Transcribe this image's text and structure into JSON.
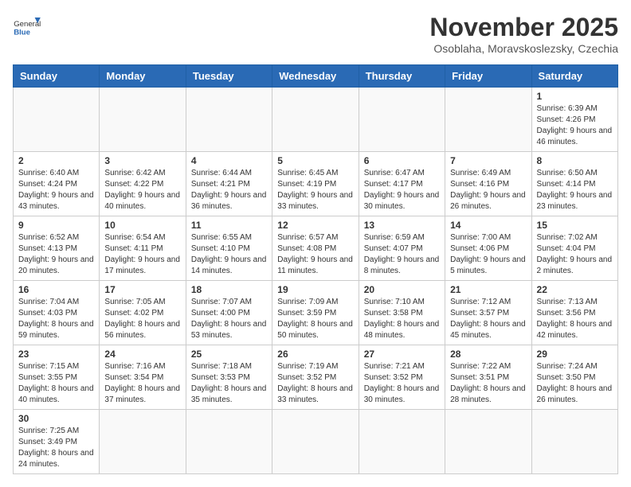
{
  "header": {
    "logo_text_normal": "General",
    "logo_text_bold": "Blue",
    "month_title": "November 2025",
    "location": "Osoblaha, Moravskoslezsky, Czechia"
  },
  "weekdays": [
    "Sunday",
    "Monday",
    "Tuesday",
    "Wednesday",
    "Thursday",
    "Friday",
    "Saturday"
  ],
  "weeks": [
    [
      {
        "day": "",
        "info": ""
      },
      {
        "day": "",
        "info": ""
      },
      {
        "day": "",
        "info": ""
      },
      {
        "day": "",
        "info": ""
      },
      {
        "day": "",
        "info": ""
      },
      {
        "day": "",
        "info": ""
      },
      {
        "day": "1",
        "info": "Sunrise: 6:39 AM\nSunset: 4:26 PM\nDaylight: 9 hours and 46 minutes."
      }
    ],
    [
      {
        "day": "2",
        "info": "Sunrise: 6:40 AM\nSunset: 4:24 PM\nDaylight: 9 hours and 43 minutes."
      },
      {
        "day": "3",
        "info": "Sunrise: 6:42 AM\nSunset: 4:22 PM\nDaylight: 9 hours and 40 minutes."
      },
      {
        "day": "4",
        "info": "Sunrise: 6:44 AM\nSunset: 4:21 PM\nDaylight: 9 hours and 36 minutes."
      },
      {
        "day": "5",
        "info": "Sunrise: 6:45 AM\nSunset: 4:19 PM\nDaylight: 9 hours and 33 minutes."
      },
      {
        "day": "6",
        "info": "Sunrise: 6:47 AM\nSunset: 4:17 PM\nDaylight: 9 hours and 30 minutes."
      },
      {
        "day": "7",
        "info": "Sunrise: 6:49 AM\nSunset: 4:16 PM\nDaylight: 9 hours and 26 minutes."
      },
      {
        "day": "8",
        "info": "Sunrise: 6:50 AM\nSunset: 4:14 PM\nDaylight: 9 hours and 23 minutes."
      }
    ],
    [
      {
        "day": "9",
        "info": "Sunrise: 6:52 AM\nSunset: 4:13 PM\nDaylight: 9 hours and 20 minutes."
      },
      {
        "day": "10",
        "info": "Sunrise: 6:54 AM\nSunset: 4:11 PM\nDaylight: 9 hours and 17 minutes."
      },
      {
        "day": "11",
        "info": "Sunrise: 6:55 AM\nSunset: 4:10 PM\nDaylight: 9 hours and 14 minutes."
      },
      {
        "day": "12",
        "info": "Sunrise: 6:57 AM\nSunset: 4:08 PM\nDaylight: 9 hours and 11 minutes."
      },
      {
        "day": "13",
        "info": "Sunrise: 6:59 AM\nSunset: 4:07 PM\nDaylight: 9 hours and 8 minutes."
      },
      {
        "day": "14",
        "info": "Sunrise: 7:00 AM\nSunset: 4:06 PM\nDaylight: 9 hours and 5 minutes."
      },
      {
        "day": "15",
        "info": "Sunrise: 7:02 AM\nSunset: 4:04 PM\nDaylight: 9 hours and 2 minutes."
      }
    ],
    [
      {
        "day": "16",
        "info": "Sunrise: 7:04 AM\nSunset: 4:03 PM\nDaylight: 8 hours and 59 minutes."
      },
      {
        "day": "17",
        "info": "Sunrise: 7:05 AM\nSunset: 4:02 PM\nDaylight: 8 hours and 56 minutes."
      },
      {
        "day": "18",
        "info": "Sunrise: 7:07 AM\nSunset: 4:00 PM\nDaylight: 8 hours and 53 minutes."
      },
      {
        "day": "19",
        "info": "Sunrise: 7:09 AM\nSunset: 3:59 PM\nDaylight: 8 hours and 50 minutes."
      },
      {
        "day": "20",
        "info": "Sunrise: 7:10 AM\nSunset: 3:58 PM\nDaylight: 8 hours and 48 minutes."
      },
      {
        "day": "21",
        "info": "Sunrise: 7:12 AM\nSunset: 3:57 PM\nDaylight: 8 hours and 45 minutes."
      },
      {
        "day": "22",
        "info": "Sunrise: 7:13 AM\nSunset: 3:56 PM\nDaylight: 8 hours and 42 minutes."
      }
    ],
    [
      {
        "day": "23",
        "info": "Sunrise: 7:15 AM\nSunset: 3:55 PM\nDaylight: 8 hours and 40 minutes."
      },
      {
        "day": "24",
        "info": "Sunrise: 7:16 AM\nSunset: 3:54 PM\nDaylight: 8 hours and 37 minutes."
      },
      {
        "day": "25",
        "info": "Sunrise: 7:18 AM\nSunset: 3:53 PM\nDaylight: 8 hours and 35 minutes."
      },
      {
        "day": "26",
        "info": "Sunrise: 7:19 AM\nSunset: 3:52 PM\nDaylight: 8 hours and 33 minutes."
      },
      {
        "day": "27",
        "info": "Sunrise: 7:21 AM\nSunset: 3:52 PM\nDaylight: 8 hours and 30 minutes."
      },
      {
        "day": "28",
        "info": "Sunrise: 7:22 AM\nSunset: 3:51 PM\nDaylight: 8 hours and 28 minutes."
      },
      {
        "day": "29",
        "info": "Sunrise: 7:24 AM\nSunset: 3:50 PM\nDaylight: 8 hours and 26 minutes."
      }
    ],
    [
      {
        "day": "30",
        "info": "Sunrise: 7:25 AM\nSunset: 3:49 PM\nDaylight: 8 hours and 24 minutes."
      },
      {
        "day": "",
        "info": ""
      },
      {
        "day": "",
        "info": ""
      },
      {
        "day": "",
        "info": ""
      },
      {
        "day": "",
        "info": ""
      },
      {
        "day": "",
        "info": ""
      },
      {
        "day": "",
        "info": ""
      }
    ]
  ]
}
